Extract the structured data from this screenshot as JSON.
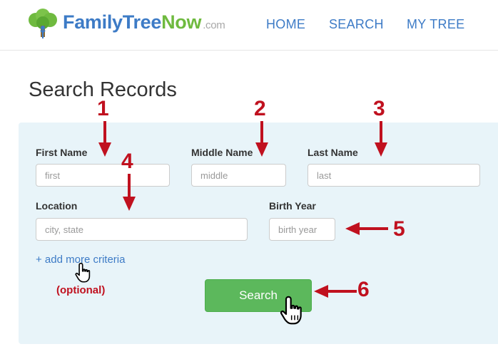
{
  "header": {
    "logo": {
      "part1": "Family",
      "part2": "Tree",
      "part3": "Now",
      "part4": ".com"
    },
    "nav": {
      "home": "HOME",
      "search": "SEARCH",
      "my_tree": "MY TREE"
    }
  },
  "page": {
    "title": "Search Records"
  },
  "form": {
    "first_name": {
      "label": "First Name",
      "placeholder": "first",
      "value": ""
    },
    "middle_name": {
      "label": "Middle Name",
      "placeholder": "middle",
      "value": ""
    },
    "last_name": {
      "label": "Last Name",
      "placeholder": "last",
      "value": ""
    },
    "location": {
      "label": "Location",
      "placeholder": "city, state",
      "value": ""
    },
    "birth_year": {
      "label": "Birth Year",
      "placeholder": "birth year",
      "value": ""
    },
    "add_more": "+ add more criteria",
    "search_button": "Search"
  },
  "annotations": {
    "numbers": [
      "1",
      "2",
      "3",
      "4",
      "5",
      "6"
    ],
    "optional_note": "(optional)",
    "color": "#c0111f"
  },
  "colors": {
    "brand_blue": "#3d7bc6",
    "brand_green": "#6fba3f",
    "panel_bg": "#e8f4f9",
    "button_green": "#5cb85c"
  },
  "icons": [
    "family-tree-logo-icon",
    "hand-pointer-cursor-icon"
  ]
}
